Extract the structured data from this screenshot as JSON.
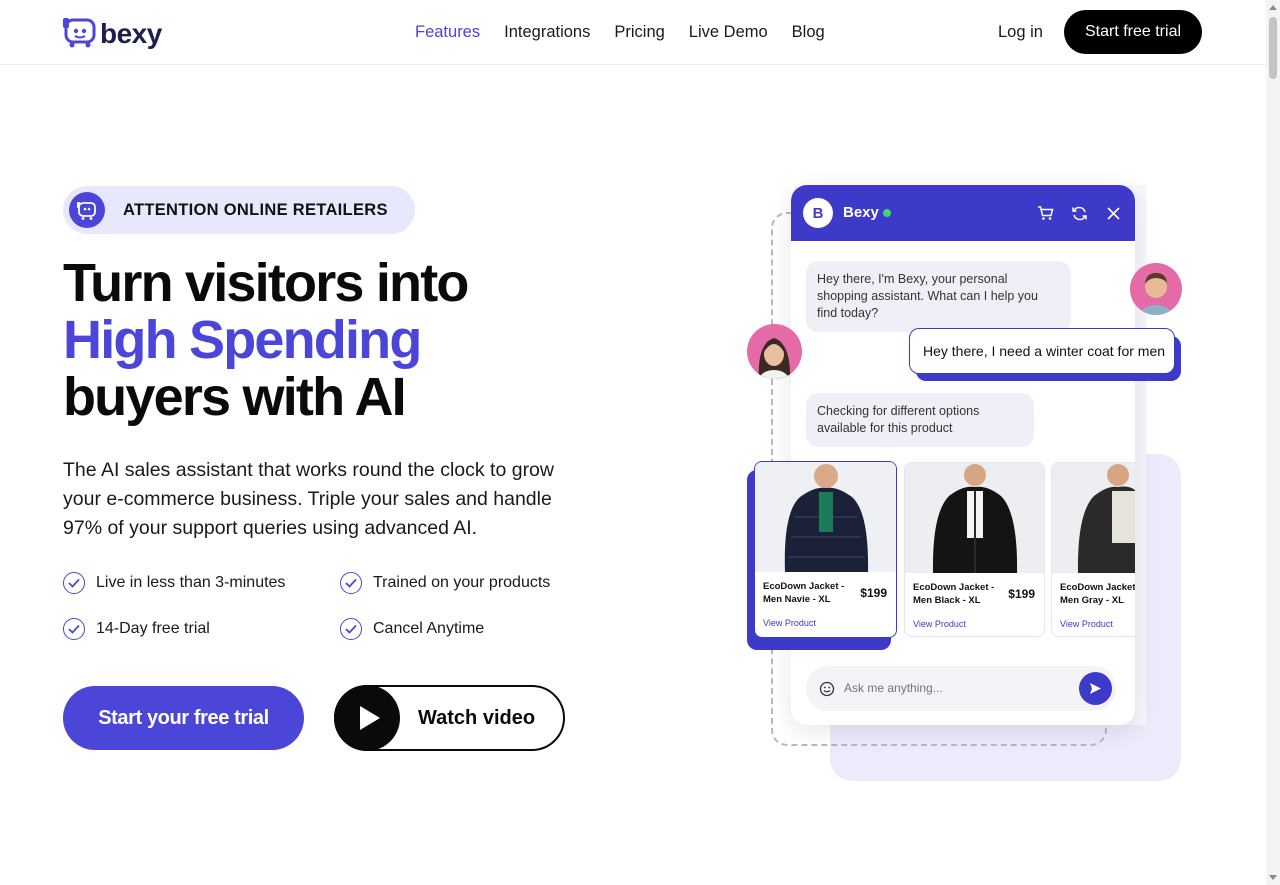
{
  "brand": {
    "name": "bexy",
    "accent": "#4b46d8"
  },
  "nav": {
    "items": [
      {
        "label": "Features",
        "active": true
      },
      {
        "label": "Integrations",
        "active": false
      },
      {
        "label": "Pricing",
        "active": false
      },
      {
        "label": "Live Demo",
        "active": false
      },
      {
        "label": "Blog",
        "active": false
      }
    ],
    "login_label": "Log in",
    "trial_label": "Start free trial"
  },
  "hero": {
    "badge": "ATTENTION ONLINE RETAILERS",
    "headline_line1": "Turn visitors into",
    "headline_accent": "High Spending",
    "headline_line3": "buyers with AI",
    "subtext": "The AI sales assistant that works round the clock to grow your e-commerce business. Triple your sales and handle 97% of your support queries using advanced AI.",
    "features": [
      "Live in less than 3-minutes",
      "Trained on your products",
      "14-Day free trial",
      "Cancel Anytime"
    ],
    "cta_primary": "Start your free trial",
    "cta_video": "Watch video"
  },
  "chat": {
    "avatar_letter": "B",
    "title": "Bexy",
    "status_color": "#3fd46c",
    "header_icons": [
      "cart-icon",
      "refresh-icon",
      "close-icon"
    ],
    "bot_greeting": "Hey there, I'm Bexy, your personal shopping assistant. What can I help you find today?",
    "user_message": "Hey there, I need a winter coat for men",
    "bot_checking": "Checking for different options available for this product",
    "products": [
      {
        "name": "EcoDown Jacket - Men Navie - XL",
        "price": "$199",
        "link": "View Product"
      },
      {
        "name": "EcoDown Jacket - Men Black - XL",
        "price": "$199",
        "link": "View Product"
      },
      {
        "name": "EcoDown Jacket - Men Gray - XL",
        "price": "",
        "link": "View Product"
      }
    ],
    "input_placeholder": "Ask me anything..."
  }
}
